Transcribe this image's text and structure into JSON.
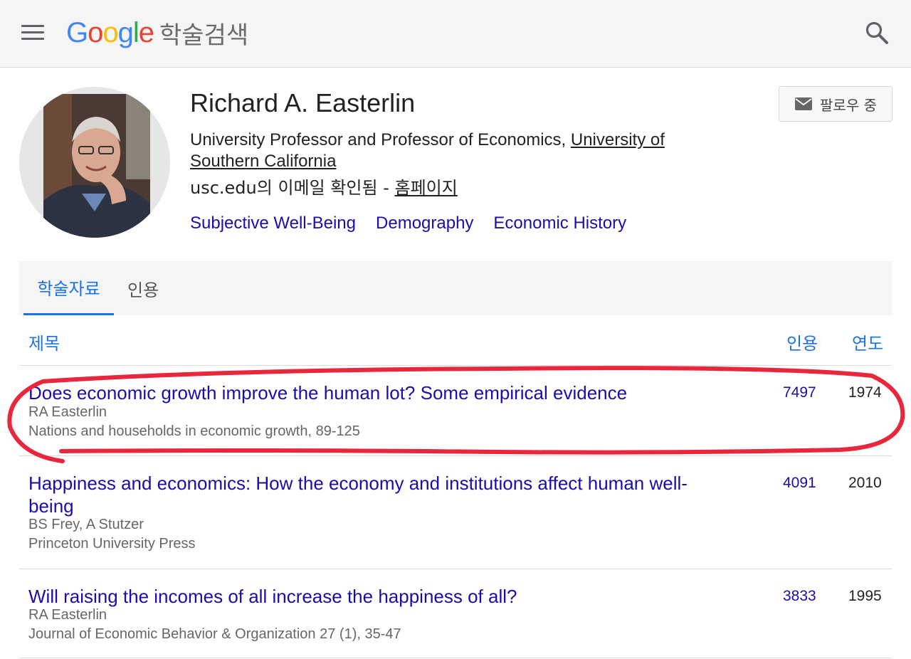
{
  "header": {
    "logo_letters": [
      {
        "ch": "G",
        "color": "#4285F4"
      },
      {
        "ch": "o",
        "color": "#EA4335"
      },
      {
        "ch": "o",
        "color": "#FBBC05"
      },
      {
        "ch": "g",
        "color": "#4285F4"
      },
      {
        "ch": "l",
        "color": "#34A853"
      },
      {
        "ch": "e",
        "color": "#EA4335"
      }
    ],
    "logo_suffix": "학술검색"
  },
  "profile": {
    "name": "Richard A. Easterlin",
    "affiliation_prefix": "University Professor and Professor of Economics, ",
    "affiliation_link": "University of Southern California",
    "email_verified": "usc.edu의 이메일 확인됨 - ",
    "homepage_link": "홈페이지",
    "interests": [
      "Subjective Well-Being",
      "Demography",
      "Economic History"
    ],
    "follow_label": "팔로우 중"
  },
  "tabs": {
    "articles": "학술자료",
    "citations": "인용"
  },
  "table": {
    "col_title": "제목",
    "col_cites": "인용",
    "col_year": "연도",
    "rows": [
      {
        "title": "Does economic growth improve the human lot? Some empirical evidence",
        "authors": "RA Easterlin",
        "venue": "Nations and households in economic growth, 89-125",
        "cites": "7497",
        "year": "1974"
      },
      {
        "title": "Happiness and economics: How the economy and institutions affect human well-being",
        "authors": "BS Frey, A Stutzer",
        "venue": "Princeton University Press",
        "cites": "4091",
        "year": "2010"
      },
      {
        "title": "Will raising the incomes of all increase the happiness of all?",
        "authors": "RA Easterlin",
        "venue": "Journal of Economic Behavior & Organization 27 (1), 35-47",
        "cites": "3833",
        "year": "1995"
      }
    ]
  },
  "colors": {
    "link": "#1a0dab",
    "accent": "#1a73e8",
    "annotation": "#e8273c"
  }
}
